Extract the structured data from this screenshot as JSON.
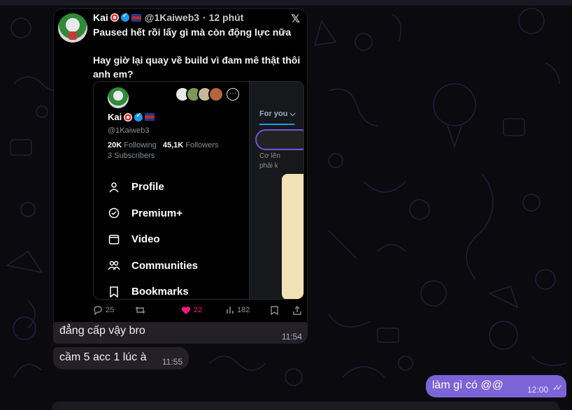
{
  "tweet": {
    "name": "Kai",
    "handle": "@1Kaiweb3",
    "time": "· 12 phút",
    "text": "Paused hết rồi lấy gì mà còn động lực nữa\n\nHay giờ lại quay về build vì đam mê thật thôi anh em?",
    "x_logo": "𝕏",
    "replies": "25",
    "likes": "22",
    "views": "182",
    "like_color": "#f9197f",
    "verified_color": "#1d9bf0"
  },
  "inner_profile": {
    "name": "Kai",
    "handle": "@1Kaiweb3",
    "following_count": "20K",
    "following_label": "Following",
    "followers_count": "45,1K",
    "followers_label": "Followers",
    "subscribers": "3 Subscribers",
    "more_glyph": "···",
    "menu": [
      {
        "label": "Profile",
        "icon": "person-icon"
      },
      {
        "label": "Premium+",
        "icon": "badge-check-icon"
      },
      {
        "label": "Video",
        "icon": "video-icon"
      },
      {
        "label": "Communities",
        "icon": "people-icon"
      },
      {
        "label": "Bookmarks",
        "icon": "bookmark-icon"
      }
    ],
    "right_tab": "For you ⌵",
    "right_text": "Cơ lên\nphải k"
  },
  "messages": [
    {
      "text": "đẳng cấp vậy bro",
      "time": "11:54",
      "side": "incoming"
    },
    {
      "text": "cầm 5 acc 1 lúc à",
      "time": "11:55",
      "side": "incoming"
    },
    {
      "text": "làm gì có @@",
      "time": "12:00",
      "side": "outgoing",
      "ticks": "✓✓"
    }
  ],
  "colors": {
    "outgoing_bubble": "#7b64d6",
    "incoming_bubble": "#232027",
    "background": "#0b0a0f"
  }
}
